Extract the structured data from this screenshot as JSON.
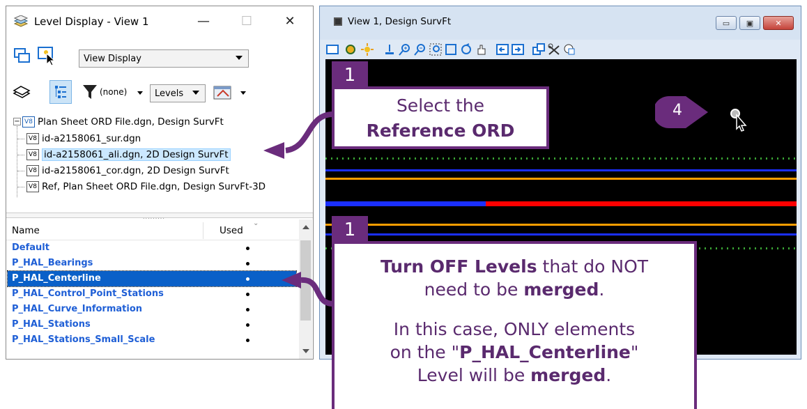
{
  "level_display": {
    "title": "Level Display - View 1",
    "view_select": "View Display",
    "filter_label": "(none)",
    "levels_combo": "Levels",
    "tree": [
      {
        "label": "Plan Sheet ORD File.dgn, Design SurvFt",
        "root": true
      },
      {
        "label": "id-a2158061_sur.dgn"
      },
      {
        "label": "id-a2158061_ali.dgn, 2D Design SurvFt",
        "selected": true
      },
      {
        "label": "id-a2158061_cor.dgn, 2D Design SurvFt"
      },
      {
        "label": "Ref, Plan Sheet ORD File.dgn, Design SurvFt-3D"
      }
    ],
    "v8_badge": "V8",
    "columns": {
      "name": "Name",
      "used": "Used"
    },
    "levels": [
      {
        "name": "Default",
        "used": true
      },
      {
        "name": "P_HAL_Bearings",
        "used": true
      },
      {
        "name": "P_HAL_Centerline",
        "used": true,
        "selected": true
      },
      {
        "name": "P_HAL_Control_Point_Stations",
        "used": true
      },
      {
        "name": "P_HAL_Curve_Information",
        "used": true
      },
      {
        "name": "P_HAL_Stations",
        "used": true
      },
      {
        "name": "P_HAL_Stations_Small_Scale",
        "used": true
      }
    ]
  },
  "view_window": {
    "title": "View 1, Design SurvFt",
    "canvas_lines": [
      {
        "color": "#3aa535",
        "style": "dotted"
      },
      {
        "color": "#1a2fff"
      },
      {
        "color": "#ff9d00"
      },
      {
        "color": "#1a2fff",
        "then_color": "#ff0000"
      },
      {
        "color": "#ff9d00"
      },
      {
        "color": "#1a2fff"
      },
      {
        "color": "#3aa535",
        "style": "dotted"
      }
    ]
  },
  "callouts": {
    "step_a": {
      "badge": "1",
      "line1": "Select the",
      "line2": "Reference ORD"
    },
    "step_b": {
      "badge": "1",
      "p1_bold": "Turn OFF Levels",
      "p1_rest1": " that do NOT",
      "p1_line2": "need to be ",
      "p1_bold2": "merged",
      "p1_end": ".",
      "p2_line1": "In this case, ONLY elements",
      "p2_pre": "on the \"",
      "p2_bold": "P_HAL_Centerline",
      "p2_post": "\"",
      "p2_line3": "Level will be ",
      "p2_bold2": "merged",
      "p2_end": "."
    },
    "step_c": {
      "badge": "4"
    }
  },
  "colors": {
    "accent": "#6a2c7c",
    "selection": "#0a60c8",
    "level_text": "#1f5fd6"
  }
}
